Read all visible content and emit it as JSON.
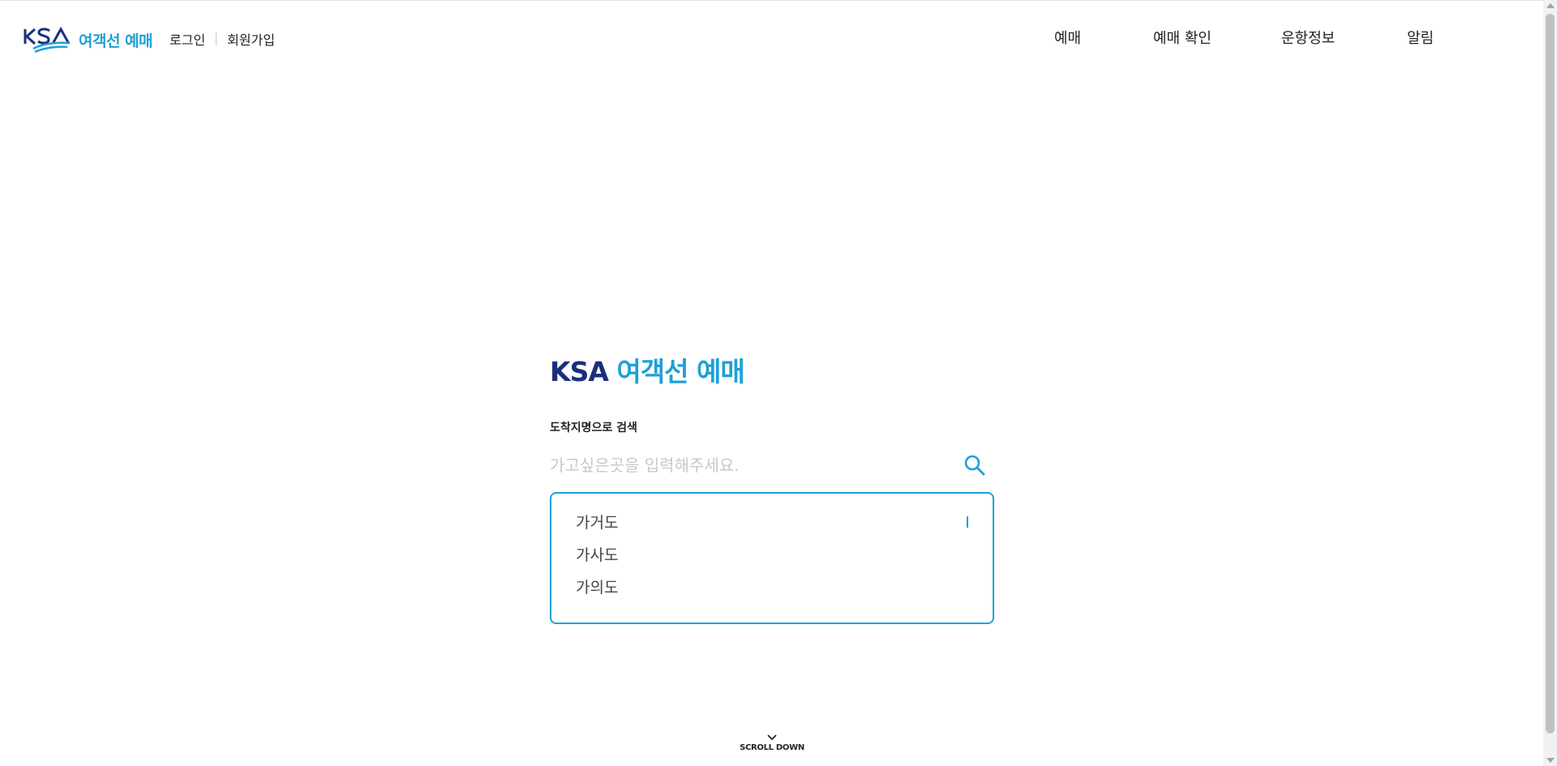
{
  "header": {
    "logo_text": "여객선 예매",
    "auth": {
      "login": "로그인",
      "signup": "회원가입"
    },
    "nav": [
      {
        "label": "예매"
      },
      {
        "label": "예매 확인"
      },
      {
        "label": "운항정보"
      },
      {
        "label": "알림"
      }
    ]
  },
  "main": {
    "title_brand": "KSA",
    "title_sub": "여객선 예매",
    "search_label": "도착지명으로 검색",
    "search_placeholder": "가고싶은곳을 입력해주세요.",
    "suggestions": [
      "가거도",
      "가사도",
      "가의도"
    ]
  },
  "scroll_down": {
    "label": "SCROLL DOWN"
  },
  "colors": {
    "accent": "#1ea0d8",
    "brand_navy": "#1b2f7a",
    "placeholder": "#c3c9d1"
  },
  "icons": {
    "search": "search-icon",
    "chevron": "chevron-down-icon"
  }
}
